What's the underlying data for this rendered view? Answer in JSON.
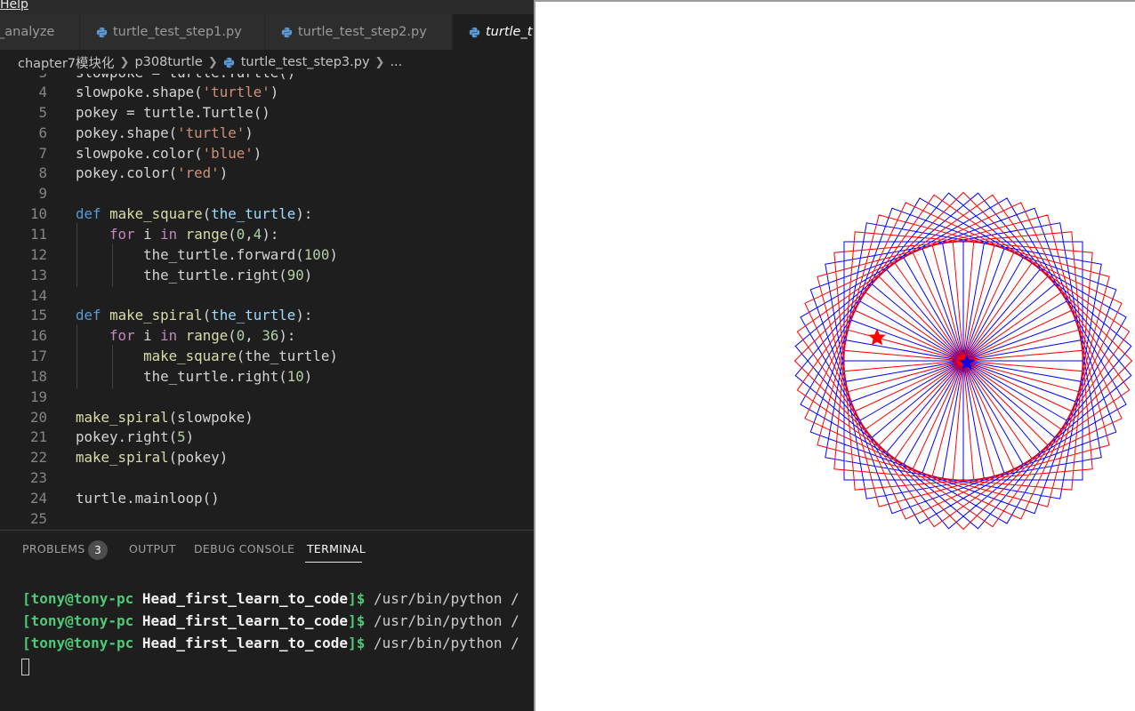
{
  "menubar": {
    "help_label": "Help"
  },
  "tabs": [
    {
      "label": "_analyze",
      "active": false
    },
    {
      "label": "turtle_test_step1.py",
      "active": false
    },
    {
      "label": "turtle_test_step2.py",
      "active": false
    },
    {
      "label": "turtle_t",
      "active": true
    }
  ],
  "breadcrumb": {
    "folder1": "chapter7模块化",
    "folder2": "p308turtle",
    "file": "turtle_test_step3.py",
    "ellipsis": "..."
  },
  "code": {
    "partial_line_number": "3",
    "partial_line_text": "slowpoke = turtle.Turtle()",
    "lines": [
      {
        "n": "4",
        "t": "slowpoke.shape('turtle')"
      },
      {
        "n": "5",
        "t": "pokey = turtle.Turtle()"
      },
      {
        "n": "6",
        "t": "pokey.shape('turtle')"
      },
      {
        "n": "7",
        "t": "slowpoke.color('blue')"
      },
      {
        "n": "8",
        "t": "pokey.color('red')"
      },
      {
        "n": "9",
        "t": ""
      },
      {
        "n": "10",
        "t": "def make_square(the_turtle):"
      },
      {
        "n": "11",
        "t": "    for i in range(0,4):"
      },
      {
        "n": "12",
        "t": "        the_turtle.forward(100)"
      },
      {
        "n": "13",
        "t": "        the_turtle.right(90)"
      },
      {
        "n": "14",
        "t": ""
      },
      {
        "n": "15",
        "t": "def make_spiral(the_turtle):"
      },
      {
        "n": "16",
        "t": "    for i in range(0, 36):"
      },
      {
        "n": "17",
        "t": "        make_square(the_turtle)"
      },
      {
        "n": "18",
        "t": "        the_turtle.right(10)"
      },
      {
        "n": "19",
        "t": ""
      },
      {
        "n": "20",
        "t": "make_spiral(slowpoke)"
      },
      {
        "n": "21",
        "t": "pokey.right(5)"
      },
      {
        "n": "22",
        "t": "make_spiral(pokey)"
      },
      {
        "n": "23",
        "t": ""
      },
      {
        "n": "24",
        "t": "turtle.mainloop()"
      },
      {
        "n": "25",
        "t": ""
      }
    ]
  },
  "panel": {
    "tabs": {
      "problems": "PROBLEMS",
      "output": "OUTPUT",
      "debug_console": "DEBUG CONSOLE",
      "terminal": "TERMINAL"
    },
    "problems_count": "3"
  },
  "terminal": {
    "user": "[tony@tony-pc",
    "dir": "Head_first_learn_to_code",
    "prompt_end": "]$",
    "command": " /usr/bin/python /",
    "line_count": 3
  },
  "turtle": {
    "spiral1_color": "#0000ff",
    "spiral2_color": "#ff0000",
    "square_side": 100,
    "squares_per_spiral": 36,
    "turn_degrees": 10,
    "pokey_offset_degrees": 5
  },
  "colors": {
    "editor_bg": "#1e1e1e",
    "keyword": "#569cd6",
    "control": "#c586c0",
    "function": "#dcdcaa",
    "string": "#ce9178",
    "number": "#b5cea8",
    "param": "#9cdcfe",
    "terminal_user": "#4ec977"
  }
}
